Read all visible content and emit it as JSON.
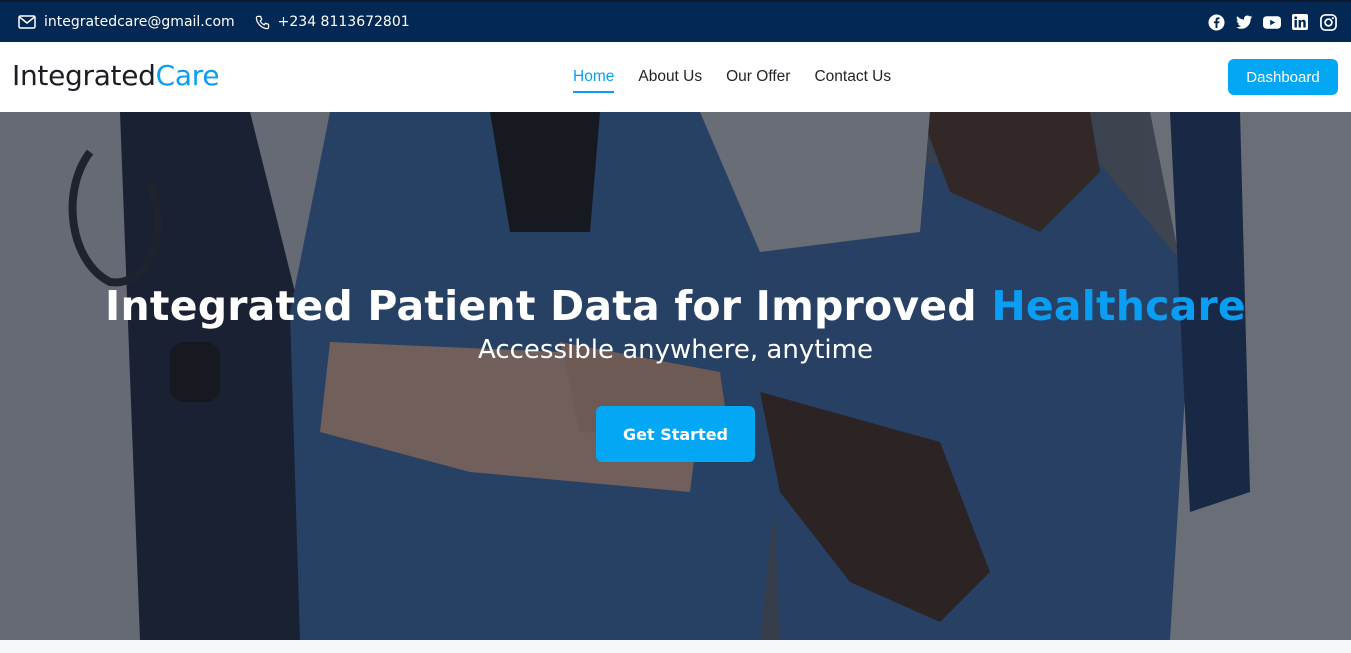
{
  "topbar": {
    "email": "integratedcare@gmail.com",
    "phone": "+234 8113672801",
    "email_icon": "mail-icon",
    "phone_icon": "phone-icon",
    "socials": [
      "facebook-icon",
      "twitter-icon",
      "youtube-icon",
      "linkedin-icon",
      "instagram-icon"
    ],
    "background_color": "#032854"
  },
  "brand": {
    "part1": "Integrated",
    "part2": "Care",
    "accent_color": "#0a9ef2"
  },
  "nav": {
    "items": [
      {
        "label": "Home",
        "active": true
      },
      {
        "label": "About Us",
        "active": false
      },
      {
        "label": "Our Offer",
        "active": false
      },
      {
        "label": "Contact Us",
        "active": false
      }
    ],
    "dashboard_label": "Dashboard"
  },
  "hero": {
    "headline_main": "Integrated Patient Data for Improved ",
    "headline_highlight": "Healthcare",
    "subheadline": "Accessible anywhere, anytime",
    "cta_label": "Get Started",
    "button_color": "#04a7f4"
  }
}
